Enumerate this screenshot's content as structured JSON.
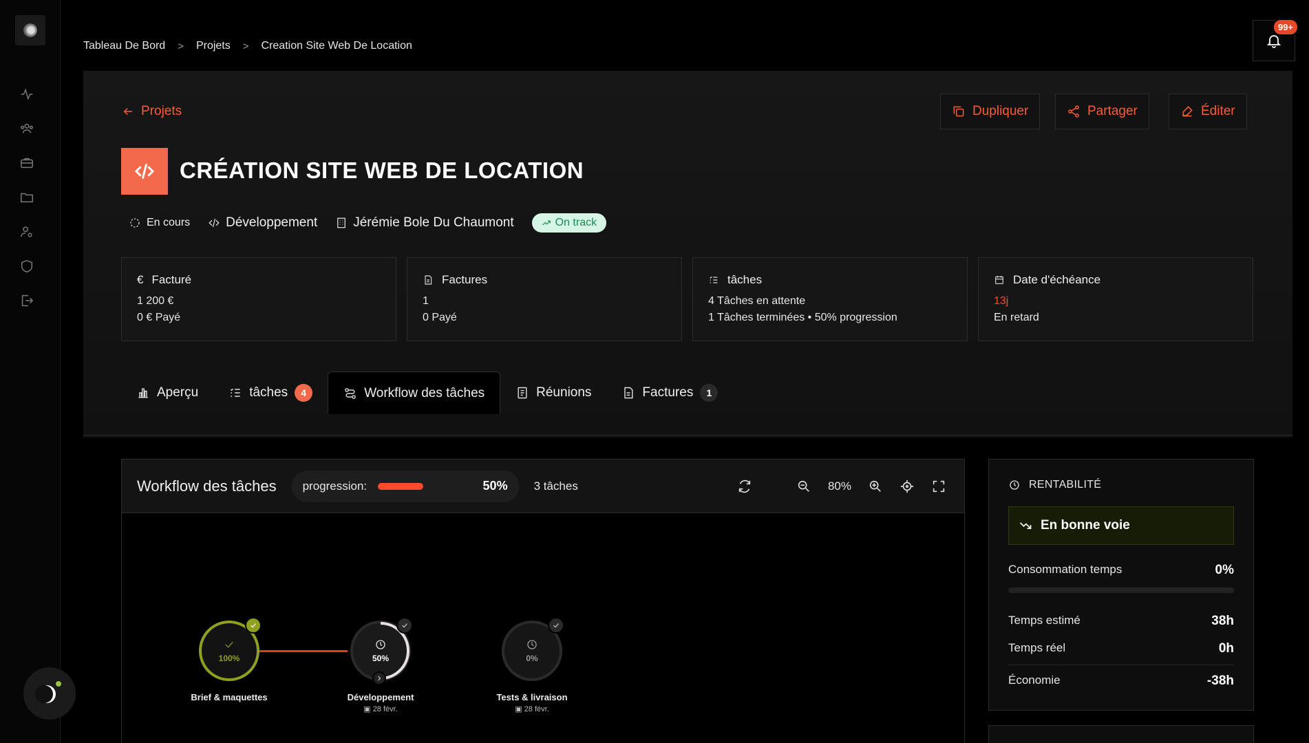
{
  "notifications": {
    "badge": "99+"
  },
  "breadcrumb": [
    "Tableau De Bord",
    "Projets",
    "Creation Site Web De Location"
  ],
  "header": {
    "back_label": "Projets",
    "actions": {
      "duplicate": "Dupliquer",
      "share": "Partager",
      "edit": "Éditer"
    },
    "title": "CRÉATION SITE WEB DE LOCATION",
    "status": "En cours",
    "category": "Développement",
    "client": "Jérémie Bole Du Chaumont",
    "health": "On track"
  },
  "stats": {
    "billed": {
      "title": "Facturé",
      "amount": "1 200 €",
      "paid": "0 € Payé"
    },
    "invoices": {
      "title": "Factures",
      "count": "1",
      "paid": "0 Payé"
    },
    "tasks": {
      "title": "tâches",
      "pending": "4 Tâches en attente",
      "done": "1 Tâches terminées • 50% progression"
    },
    "due": {
      "title": "Date d'échéance",
      "days": "13j",
      "status": "En retard"
    }
  },
  "tabs": [
    {
      "label": "Aperçu"
    },
    {
      "label": "tâches",
      "count": "4"
    },
    {
      "label": "Workflow des tâches"
    },
    {
      "label": "Réunions"
    },
    {
      "label": "Factures",
      "count": "1"
    }
  ],
  "workflow": {
    "title": "Workflow des tâches",
    "progress_label": "progression:",
    "progress_value": "50%",
    "progress": 0.5,
    "task_count": "3 tâches",
    "zoom": "80%",
    "nodes": [
      {
        "name": "Brief & maquettes",
        "pct": "100%",
        "date": ""
      },
      {
        "name": "Développement",
        "pct": "50%",
        "date": "28 févr."
      },
      {
        "name": "Tests & livraison",
        "pct": "0%",
        "date": "28 févr."
      }
    ]
  },
  "profitability": {
    "title": "RENTABILITÉ",
    "status": "En bonne voie",
    "time_consumption_label": "Consommation temps",
    "time_consumption_value": "0%",
    "estimated_label": "Temps estimé",
    "estimated_value": "38h",
    "actual_label": "Temps réel",
    "actual_value": "0h",
    "savings_label": "Économie",
    "savings_value": "-38h"
  },
  "colors": {
    "accent": "#ff5a36",
    "success": "#9bc53d",
    "danger": "#ff4a2b"
  }
}
